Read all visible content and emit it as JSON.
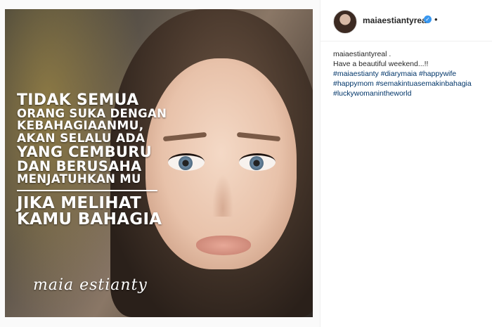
{
  "post": {
    "username": "maiaestiantyreal",
    "header_separator": "•",
    "verified_icon": "check-icon",
    "photo": {
      "quote_lines": [
        "TIDAK SEMUA",
        "ORANG SUKA DENGAN",
        "KEBAHAGIAANMU,",
        "AKAN SELALU ADA",
        "YANG CEMBURU",
        "DAN BERUSAHA",
        "MENJATUHKAN MU",
        "JIKA MELIHAT",
        "KAMU BAHAGIA"
      ],
      "signature": "maia estianty"
    },
    "caption": {
      "user": "maiaestiantyreal",
      "after_user": " .",
      "text": "Have a beautiful weekend...!!",
      "hashtag_rows": [
        [
          "#maiaestianty",
          "#diarymaia",
          "#happywife"
        ],
        [
          "#happymom",
          "#semakintuasemakinbahagia"
        ],
        [
          "#luckywomanintheworld"
        ]
      ]
    },
    "colors": {
      "verified": "#3897f0",
      "hashtag": "#003569",
      "text": "#262626"
    }
  }
}
